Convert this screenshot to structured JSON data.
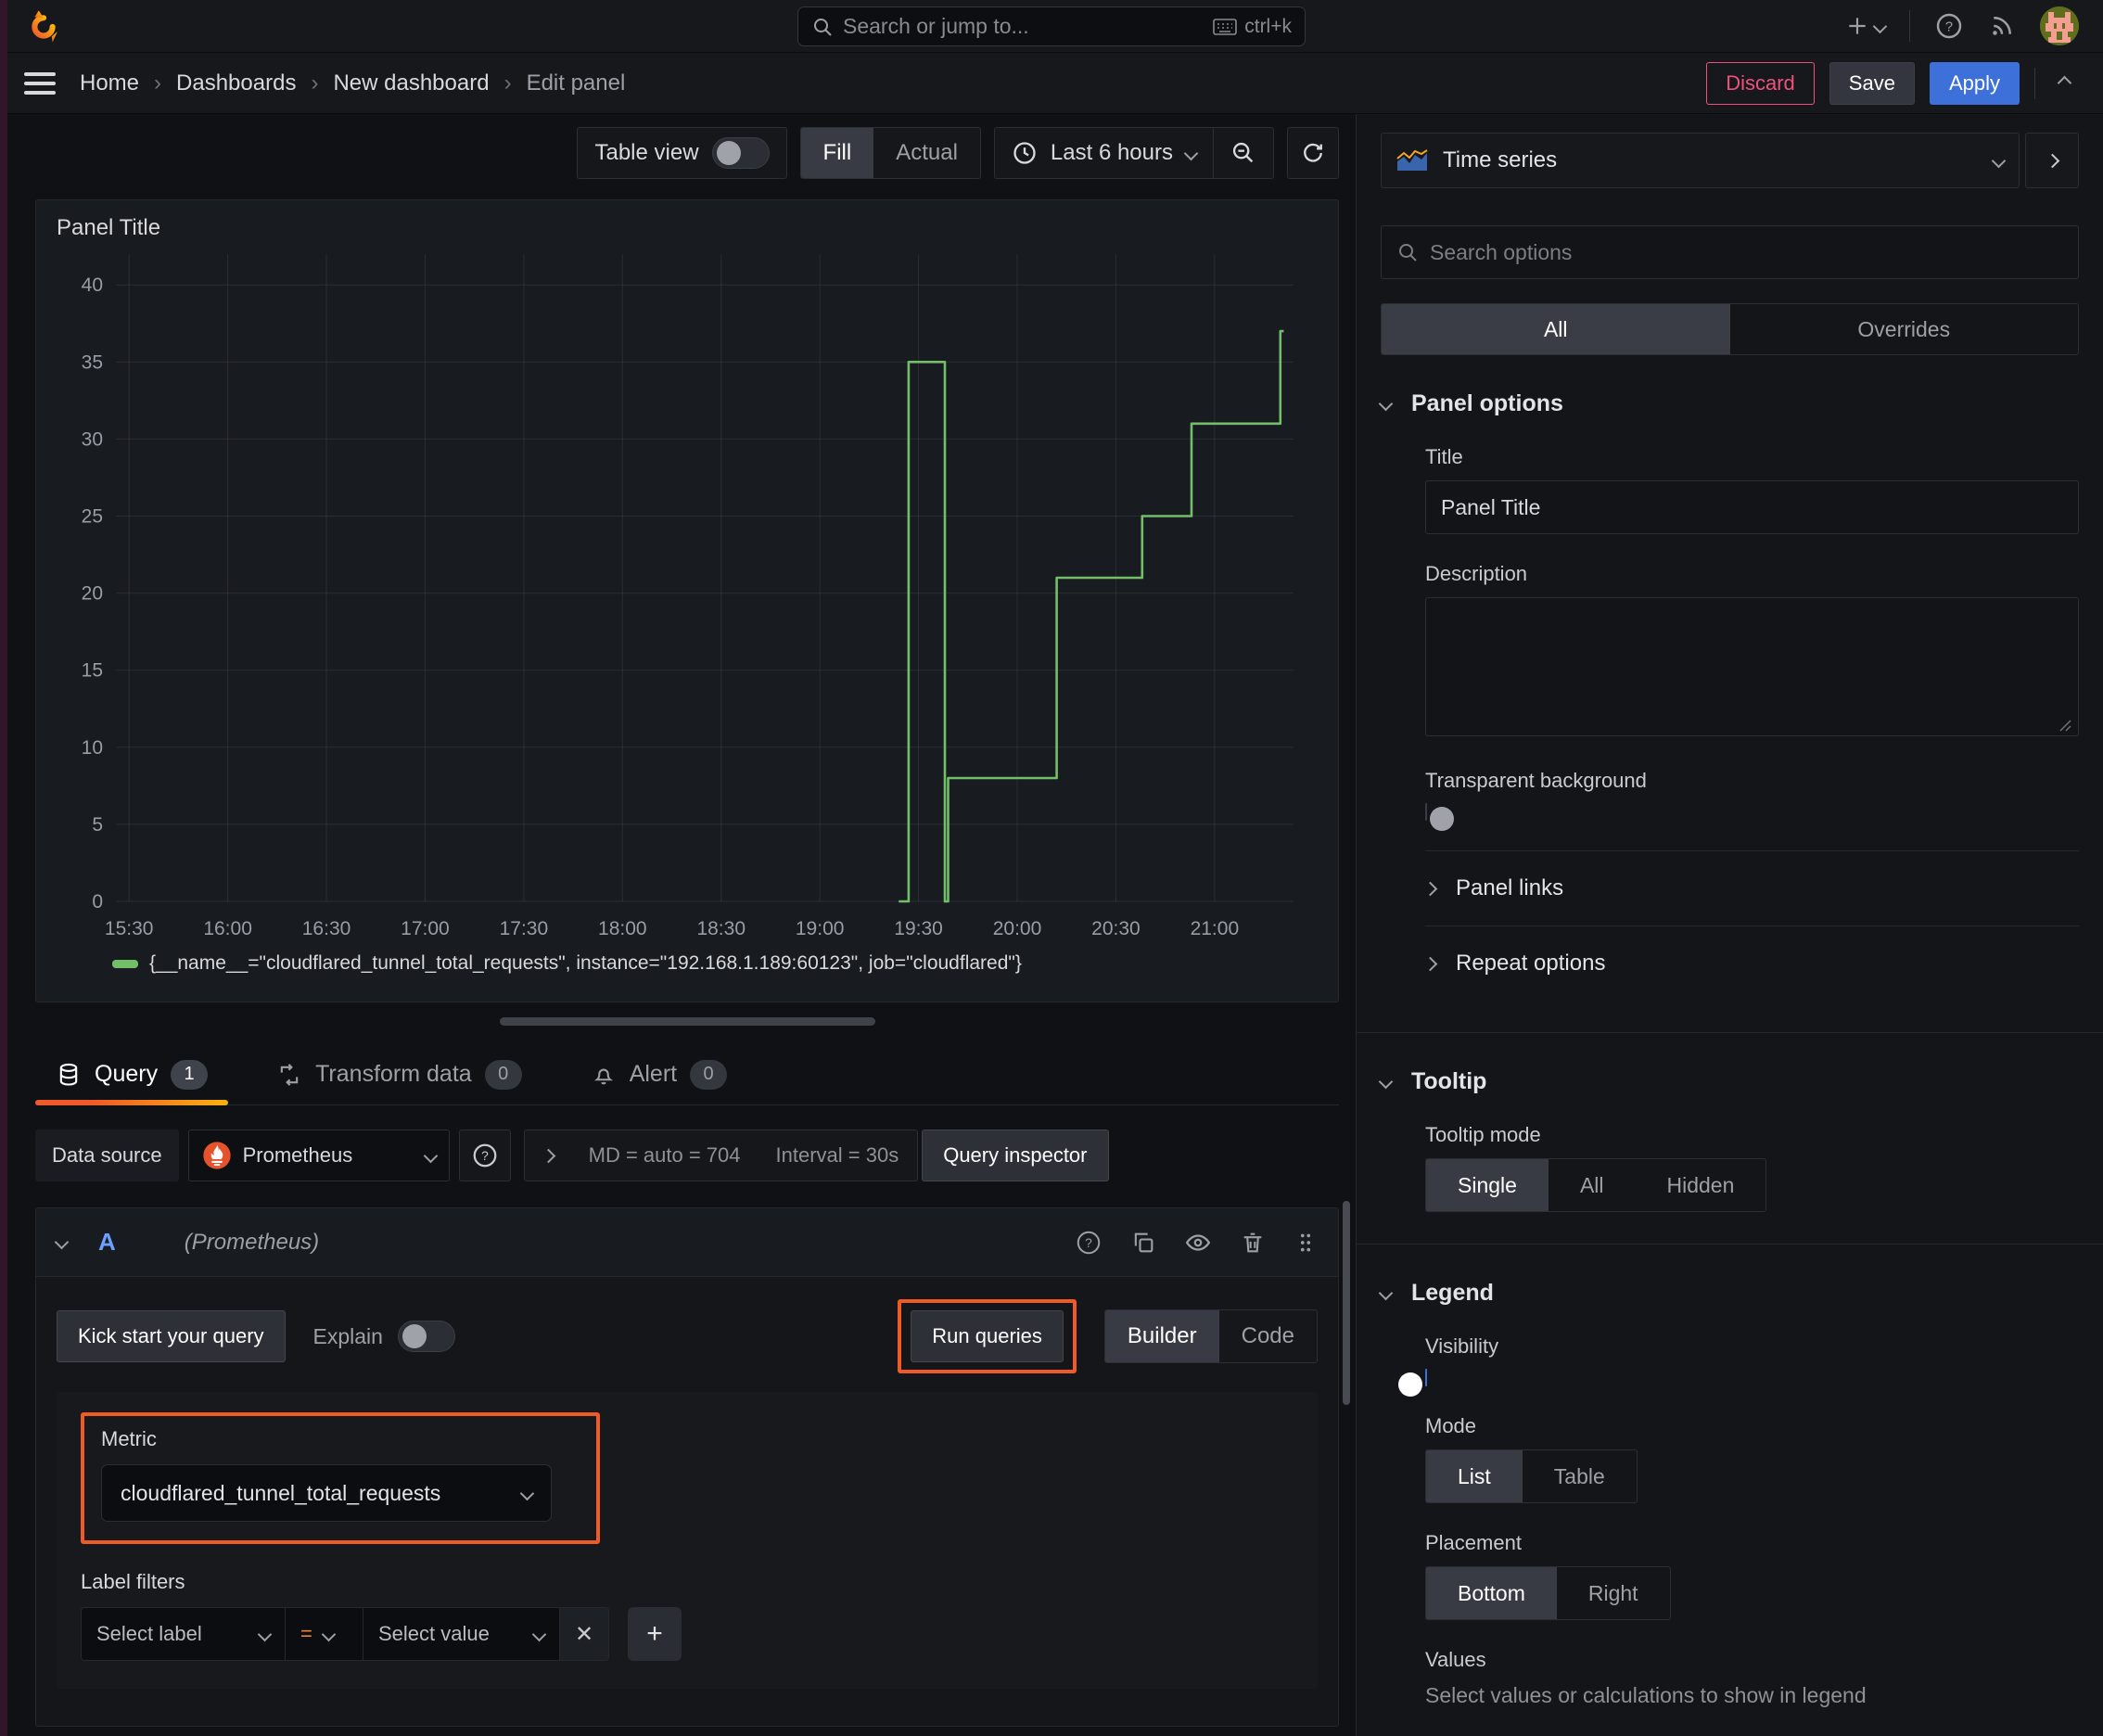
{
  "topbar": {
    "search_placeholder": "Search or jump to...",
    "shortcut": "ctrl+k"
  },
  "nav": {
    "breadcrumbs": [
      "Home",
      "Dashboards",
      "New dashboard",
      "Edit panel"
    ],
    "discard": "Discard",
    "save": "Save",
    "apply": "Apply"
  },
  "toolbar": {
    "table_view": "Table view",
    "fill": "Fill",
    "actual": "Actual",
    "time_range": "Last 6 hours"
  },
  "panel": {
    "title": "Panel Title"
  },
  "chart_data": {
    "type": "line",
    "step": true,
    "title": "Panel Title",
    "grid": true,
    "legend_position": "bottom",
    "xlabel": "",
    "ylabel": "",
    "x_ticks": [
      "15:30",
      "16:00",
      "16:30",
      "17:00",
      "17:30",
      "18:00",
      "18:30",
      "19:00",
      "19:30",
      "20:00",
      "20:30",
      "21:00"
    ],
    "x_domain": [
      "15:26",
      "21:24"
    ],
    "y_ticks": [
      0,
      5,
      10,
      15,
      20,
      25,
      30,
      35,
      40
    ],
    "ylim": [
      0,
      42
    ],
    "series": [
      {
        "name": "{__name__=\"cloudflared_tunnel_total_requests\", instance=\"192.168.1.189:60123\", job=\"cloudflared\"}",
        "color": "#73bf69",
        "points": [
          {
            "t": "19:24",
            "v": 0
          },
          {
            "t": "19:27",
            "v": 35
          },
          {
            "t": "19:38",
            "v": 0
          },
          {
            "t": "19:39",
            "v": 8
          },
          {
            "t": "20:12",
            "v": 21
          },
          {
            "t": "20:38",
            "v": 25
          },
          {
            "t": "20:53",
            "v": 31
          },
          {
            "t": "21:20",
            "v": 37
          },
          {
            "t": "21:21",
            "v": 37
          }
        ]
      }
    ]
  },
  "tabs": {
    "query": "Query",
    "query_count": "1",
    "transform": "Transform data",
    "transform_count": "0",
    "alert": "Alert",
    "alert_count": "0"
  },
  "datasource": {
    "label": "Data source",
    "name": "Prometheus",
    "stat_md": "MD = auto = 704",
    "stat_interval": "Interval = 30s",
    "inspector": "Query inspector"
  },
  "query": {
    "ref_id": "A",
    "ds_hint": "(Prometheus)",
    "kick_start": "Kick start your query",
    "explain": "Explain",
    "run_queries": "Run queries",
    "builder": "Builder",
    "code": "Code",
    "metric_label": "Metric",
    "metric_value": "cloudflared_tunnel_total_requests",
    "label_filters": "Label filters",
    "select_label": "Select label",
    "operator": "=",
    "select_value": "Select value"
  },
  "options": {
    "viz": "Time series",
    "search_placeholder": "Search options",
    "tab_all": "All",
    "tab_overrides": "Overrides",
    "panel_options": {
      "header": "Panel options",
      "title_label": "Title",
      "title_value": "Panel Title",
      "description_label": "Description",
      "transparent": "Transparent background",
      "panel_links": "Panel links",
      "repeat": "Repeat options"
    },
    "tooltip": {
      "header": "Tooltip",
      "mode_label": "Tooltip mode",
      "single": "Single",
      "all": "All",
      "hidden": "Hidden"
    },
    "legend": {
      "header": "Legend",
      "visibility": "Visibility",
      "mode": "Mode",
      "list": "List",
      "table": "Table",
      "placement": "Placement",
      "bottom": "Bottom",
      "right": "Right",
      "values": "Values",
      "values_hint": "Select values or calculations to show in legend"
    }
  },
  "colors": {
    "accent_orange": "#ff780a",
    "annotation_orange": "#f05a24",
    "series_green": "#73bf69",
    "primary_blue": "#3d71d9",
    "discard_pink": "#ef517c"
  }
}
